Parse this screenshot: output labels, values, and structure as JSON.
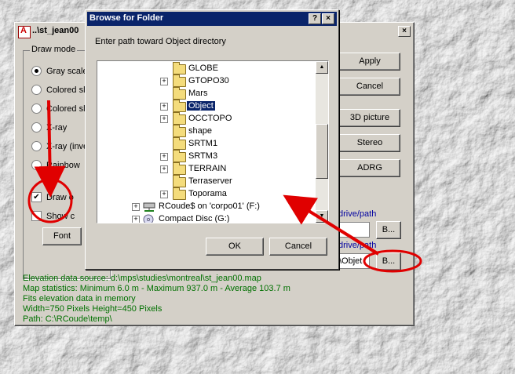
{
  "main_window": {
    "title": "..\\st_jean00",
    "draw_mode": {
      "label": "Draw mode",
      "options": [
        "Gray scale",
        "Colored slo",
        "Colored slo",
        "X-ray",
        "X-ray (inve",
        "Rainbow"
      ],
      "selected_index": 0
    },
    "draw_checkbox": {
      "label": "Draw o",
      "checked": true
    },
    "show_checkbox": {
      "label": "Show c",
      "checked": false
    },
    "font_button": "Font",
    "buttons": {
      "apply": "Apply",
      "cancel": "Cancel",
      "picture_3d": "3D picture",
      "stereo": "Stereo",
      "adrg": "ADRG"
    },
    "drive_path_label_1": "drive/path",
    "drive_path_label_2": "drive/path",
    "browse_button_1": "B...",
    "browse_button_2": "B...",
    "path_field_value": "\\Objet",
    "info": [
      "Elevation data source: d:\\mps\\studies\\montreal\\st_jean00.map",
      "Map statistics: Minimum 6.0 m - Maximum 937.0 m - Average 103.7 m",
      "Fits elevation data in memory",
      "Width=750 Pixels  Height=450 Pixels",
      "Path: C:\\RCoude\\temp\\"
    ]
  },
  "browse_dialog": {
    "title": "Browse for Folder",
    "help_button": "?",
    "close_button": "×",
    "prompt": "Enter path toward Object directory",
    "tree": [
      {
        "label": "GLOBE",
        "expandable": false
      },
      {
        "label": "GTOPO30",
        "expandable": true
      },
      {
        "label": "Mars",
        "expandable": false
      },
      {
        "label": "Object",
        "expandable": true,
        "selected": true
      },
      {
        "label": "OCCTOPO",
        "expandable": true
      },
      {
        "label": "shape",
        "expandable": false
      },
      {
        "label": "SRTM1",
        "expandable": false
      },
      {
        "label": "SRTM3",
        "expandable": true
      },
      {
        "label": "TERRAIN",
        "expandable": true
      },
      {
        "label": "Terraserver",
        "expandable": false
      },
      {
        "label": "Toporama",
        "expandable": true
      }
    ],
    "drive_1": "RCoude$ on 'corpo01' (F:)",
    "drive_2": "Compact Disc (G:)",
    "ok_button": "OK",
    "cancel_button": "Cancel"
  },
  "colors": {
    "title_bar": "#0a246a",
    "dialog_bg": "#d4d0c8",
    "annotation_red": "#e00000",
    "info_text": "#007000",
    "link_blue": "#0000a0"
  }
}
